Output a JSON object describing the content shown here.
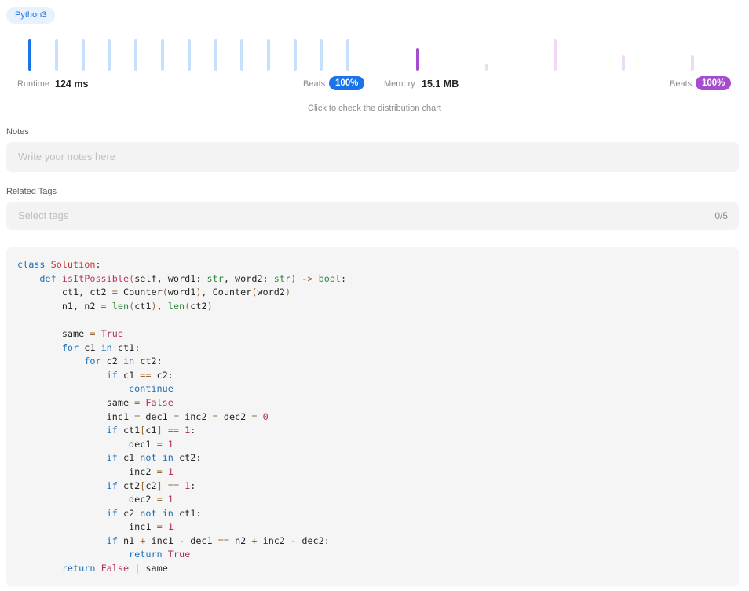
{
  "language": "Python3",
  "runtime": {
    "label": "Runtime",
    "value": "124 ms",
    "beats_label": "Beats",
    "beats": "100%",
    "beats_fraction": 1.0
  },
  "memory": {
    "label": "Memory",
    "value": "15.1 MB",
    "beats_label": "Beats",
    "beats": "100%",
    "beats_fraction": 1.0
  },
  "colors": {
    "runtime_accent": "#1a73e8",
    "runtime_bar": "#c6e0fb",
    "memory_accent": "#a64ccf",
    "memory_bar": "#efd9f6"
  },
  "distribution_hint": "Click to check the distribution chart",
  "notes": {
    "label": "Notes",
    "placeholder": "Write your notes here"
  },
  "tags": {
    "label": "Related Tags",
    "placeholder": "Select tags",
    "count": "0/5"
  },
  "code": {
    "lines": [
      "class Solution:",
      "    def isItPossible(self, word1: str, word2: str) -> bool:",
      "        ct1, ct2 = Counter(word1), Counter(word2)",
      "        n1, n2 = len(ct1), len(ct2)",
      "",
      "        same = True",
      "        for c1 in ct1:",
      "            for c2 in ct2:",
      "                if c1 == c2:",
      "                    continue",
      "                same = False",
      "                inc1 = dec1 = inc2 = dec2 = 0",
      "                if ct1[c1] == 1:",
      "                    dec1 = 1",
      "                if c1 not in ct2:",
      "                    inc2 = 1",
      "                if ct2[c2] == 1:",
      "                    dec2 = 1",
      "                if c2 not in ct1:",
      "                    inc1 = 1",
      "                if n1 + inc1 - dec1 == n2 + inc2 - dec2:",
      "                    return True",
      "        return False | same"
    ]
  }
}
